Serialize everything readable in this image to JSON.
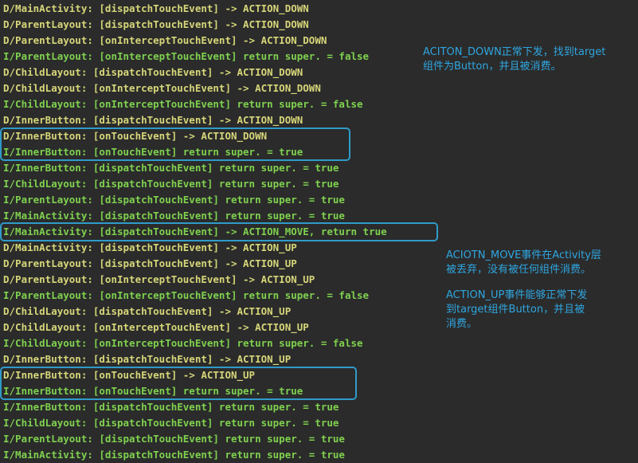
{
  "colors": {
    "background": "#2b2b2b",
    "debug_text": "#d6d67a",
    "info_text": "#7fd14f",
    "highlight_border": "#2f9bc9",
    "annotation_text": "#2fa6e0"
  },
  "log_lines": [
    {
      "level": "D",
      "text": "D/MainActivity: [dispatchTouchEvent] -> ACTION_DOWN"
    },
    {
      "level": "D",
      "text": "D/ParentLayout: [dispatchTouchEvent] -> ACTION_DOWN"
    },
    {
      "level": "D",
      "text": "D/ParentLayout: [onInterceptTouchEvent] -> ACTION_DOWN"
    },
    {
      "level": "I",
      "text": "I/ParentLayout: [onInterceptTouchEvent] return super. = false"
    },
    {
      "level": "D",
      "text": "D/ChildLayout: [dispatchTouchEvent] -> ACTION_DOWN"
    },
    {
      "level": "D",
      "text": "D/ChildLayout: [onInterceptTouchEvent] -> ACTION_DOWN"
    },
    {
      "level": "I",
      "text": "I/ChildLayout: [onInterceptTouchEvent] return super. = false"
    },
    {
      "level": "D",
      "text": "D/InnerButton: [dispatchTouchEvent] -> ACTION_DOWN"
    },
    {
      "level": "D",
      "text": "D/InnerButton: [onTouchEvent] -> ACTION_DOWN"
    },
    {
      "level": "I",
      "text": "I/InnerButton: [onTouchEvent] return super. = true"
    },
    {
      "level": "I",
      "text": "I/InnerButton: [dispatchTouchEvent] return super. = true"
    },
    {
      "level": "I",
      "text": "I/ChildLayout: [dispatchTouchEvent] return super. = true"
    },
    {
      "level": "I",
      "text": "I/ParentLayout: [dispatchTouchEvent] return super. = true"
    },
    {
      "level": "I",
      "text": "I/MainActivity: [dispatchTouchEvent] return super. = true"
    },
    {
      "level": "I",
      "text": "I/MainActivity: [dispatchTouchEvent] -> ACTION_MOVE, return true"
    },
    {
      "level": "D",
      "text": "D/MainActivity: [dispatchTouchEvent] -> ACTION_UP"
    },
    {
      "level": "D",
      "text": "D/ParentLayout: [dispatchTouchEvent] -> ACTION_UP"
    },
    {
      "level": "D",
      "text": "D/ParentLayout: [onInterceptTouchEvent] -> ACTION_UP"
    },
    {
      "level": "I",
      "text": "I/ParentLayout: [onInterceptTouchEvent] return super. = false"
    },
    {
      "level": "D",
      "text": "D/ChildLayout: [dispatchTouchEvent] -> ACTION_UP"
    },
    {
      "level": "D",
      "text": "D/ChildLayout: [onInterceptTouchEvent] -> ACTION_UP"
    },
    {
      "level": "I",
      "text": "I/ChildLayout: [onInterceptTouchEvent] return super. = false"
    },
    {
      "level": "D",
      "text": "D/InnerButton: [dispatchTouchEvent] -> ACTION_UP"
    },
    {
      "level": "D",
      "text": "D/InnerButton: [onTouchEvent] -> ACTION_UP"
    },
    {
      "level": "I",
      "text": "I/InnerButton: [onTouchEvent] return super. = true"
    },
    {
      "level": "I",
      "text": "I/InnerButton: [dispatchTouchEvent] return super. = true"
    },
    {
      "level": "I",
      "text": "I/ChildLayout: [dispatchTouchEvent] return super. = true"
    },
    {
      "level": "I",
      "text": "I/ParentLayout: [dispatchTouchEvent] return super. = true"
    },
    {
      "level": "I",
      "text": "I/MainActivity: [dispatchTouchEvent] return super. = true"
    }
  ],
  "annotations": {
    "down": {
      "line1": "ACITON_DOWN正常下发，找到target",
      "line2": "组件为Button，并且被消费。"
    },
    "move": {
      "line1": "ACIOTN_MOVE事件在Activity层",
      "line2": "被丢弃，没有被任何组件消费。"
    },
    "up": {
      "line1": "ACTION_UP事件能够正常下发",
      "line2": "到target组件Button，并且被",
      "line3": "消费。"
    }
  }
}
